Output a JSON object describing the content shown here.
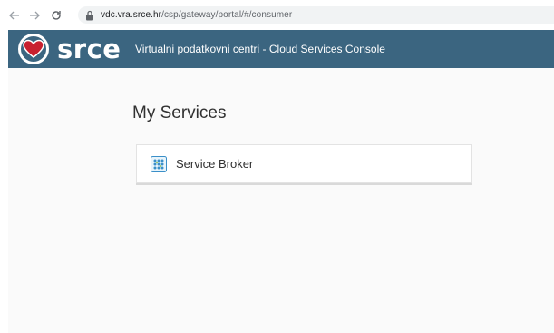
{
  "browser": {
    "url_host": "vdc.vra.srce.hr",
    "url_path": "/csp/gateway/portal/#/consumer"
  },
  "header": {
    "logo_text": "srce",
    "title": "Virtualni podatkovni centri - Cloud Services Console"
  },
  "main": {
    "page_title": "My Services",
    "services": [
      {
        "label": "Service Broker",
        "icon": "service-broker-icon"
      }
    ]
  },
  "colors": {
    "header_bg": "#3b6580",
    "content_bg": "#fafafa",
    "logo_heart": "#c8202f"
  }
}
